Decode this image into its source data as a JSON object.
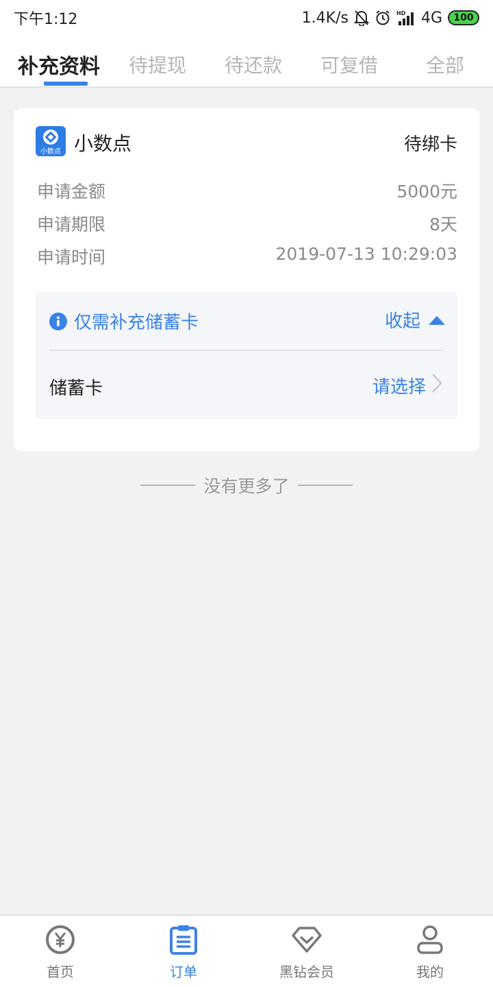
{
  "status_bar": {
    "time": "下午1:12",
    "speed": "1.4K/s",
    "signal_hd": "HD",
    "network": "4G",
    "battery": "100"
  },
  "tabs": [
    {
      "label": "补充资料",
      "active": true
    },
    {
      "label": "待提现",
      "active": false
    },
    {
      "label": "待还款",
      "active": false
    },
    {
      "label": "可复借",
      "active": false
    },
    {
      "label": "全部",
      "active": false
    }
  ],
  "order": {
    "lender_name": "小数点",
    "logo_text": "小数点",
    "status": "待绑卡",
    "rows": [
      {
        "label": "申请金额",
        "value": "5000元"
      },
      {
        "label": "申请期限",
        "value": "8天"
      },
      {
        "label": "申请时间",
        "value": "2019-07-13 10:29:03"
      }
    ],
    "panel": {
      "message": "仅需补充储蓄卡",
      "collapse_label": "收起",
      "field_label": "储蓄卡",
      "select_label": "请选择"
    }
  },
  "list_end": "没有更多了",
  "bottom_nav": [
    {
      "label": "首页",
      "icon": "yen-icon",
      "active": false
    },
    {
      "label": "订单",
      "icon": "order-list-icon",
      "active": true
    },
    {
      "label": "黑钻会员",
      "icon": "diamond-icon",
      "active": false
    },
    {
      "label": "我的",
      "icon": "user-icon",
      "active": false
    }
  ],
  "colors": {
    "accent": "#3b82e6",
    "background": "#f2f2f3",
    "battery": "#4bd34b"
  }
}
